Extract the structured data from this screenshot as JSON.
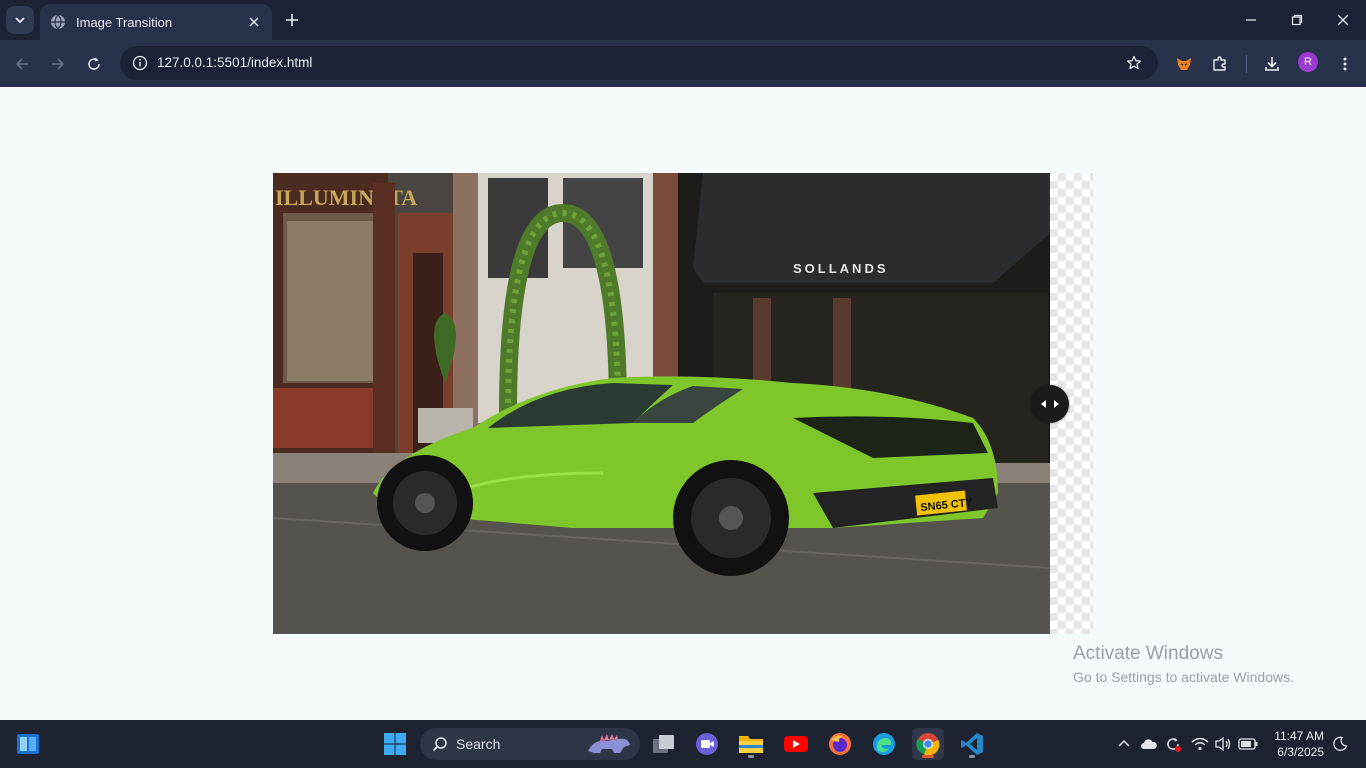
{
  "browser": {
    "tab": {
      "title": "Image Transition",
      "icon": "globe-icon"
    },
    "toolbar": {
      "url": "127.0.0.1:5501/index.html",
      "profile_initial": "R"
    }
  },
  "page": {
    "image": {
      "subject": "green-sports-car",
      "sign_left": "ILLUMINATA",
      "sign_right": "SOLLANDS",
      "plate": "SN65 CTY"
    },
    "slider": {
      "handle_icon": "left-right-arrows-icon"
    }
  },
  "watermark": {
    "title": "Activate Windows",
    "subtitle": "Go to Settings to activate Windows."
  },
  "taskbar": {
    "search_label": "Search",
    "clock": {
      "time": "11:47 AM",
      "date": "6/3/2025"
    }
  },
  "colors": {
    "tab_strip": "#1b2236",
    "toolbar": "#28314a",
    "page_bg": "#f5fbfd",
    "car_green": "#7ec62a",
    "taskbar": "#1c2230"
  }
}
